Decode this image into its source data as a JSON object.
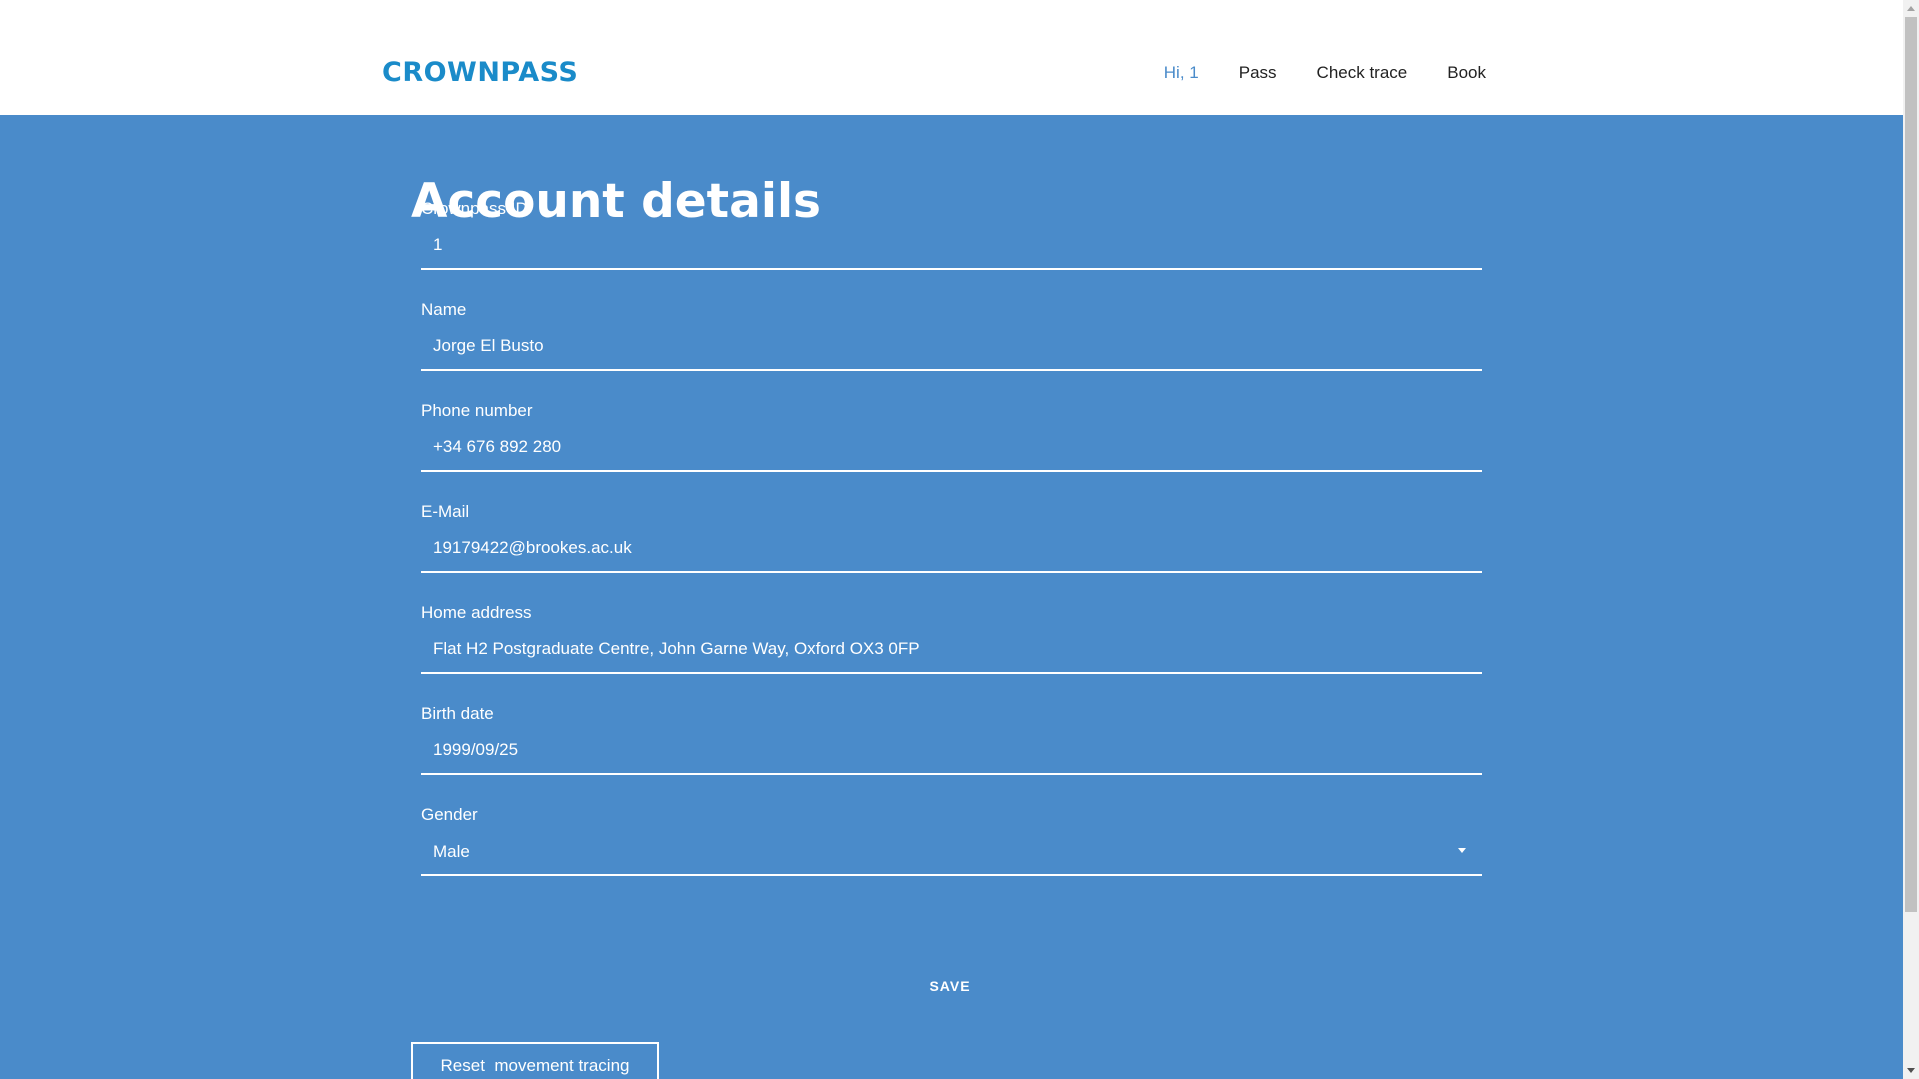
{
  "header": {
    "logo": "CROWNPASS",
    "nav": {
      "greeting": "Hi, 1",
      "pass": "Pass",
      "check_trace": "Check trace",
      "book": "Book"
    }
  },
  "main": {
    "title": "Account details",
    "fields": {
      "crownpass_id": {
        "label": "Crownpass ID",
        "value": "1"
      },
      "name": {
        "label": "Name",
        "value": "Jorge El Busto"
      },
      "phone": {
        "label": "Phone number",
        "value": "+34 676 892 280"
      },
      "email": {
        "label": "E-Mail",
        "value": "19179422@brookes.ac.uk"
      },
      "address": {
        "label": "Home address",
        "value": "Flat H2 Postgraduate Centre, John Garne Way, Oxford OX3 0FP"
      },
      "birth_date": {
        "label": "Birth date",
        "value": "1999/09/25"
      },
      "gender": {
        "label": "Gender",
        "value": "Male"
      }
    },
    "save_label": "SAVE",
    "reset_label": "Reset  movement tracing"
  },
  "colors": {
    "background": "#4a8bca",
    "brand": "#1a8bc9",
    "text_on_bg": "#ffffff"
  }
}
